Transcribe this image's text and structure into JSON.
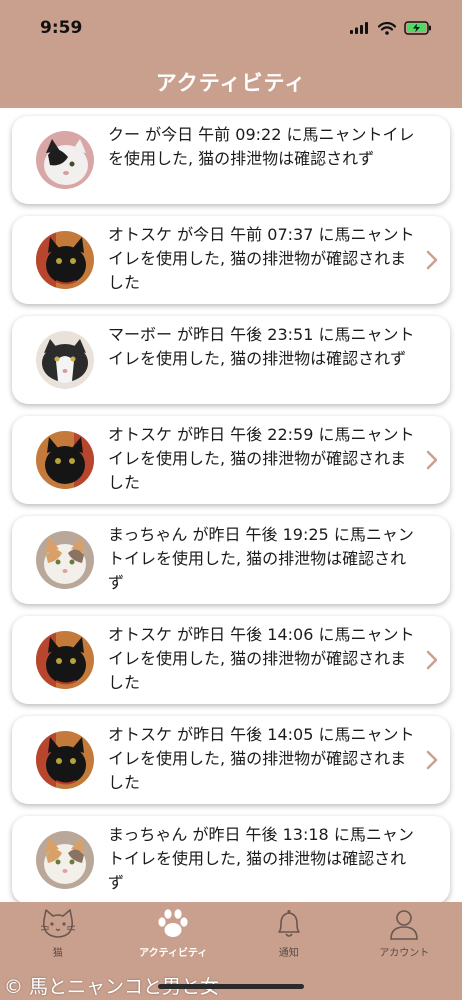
{
  "status_bar": {
    "time": "9:59"
  },
  "header": {
    "title": "アクティビティ"
  },
  "activities": [
    {
      "cat": "kuu",
      "text": "クー が今日 午前 09:22 に馬ニャントイレを使用した, 猫の排泄物は確認されず",
      "has_chevron": false
    },
    {
      "cat": "otosuke",
      "text": "オトスケ が今日 午前 07:37 に馬ニャントイレを使用した, 猫の排泄物が確認されました",
      "has_chevron": true
    },
    {
      "cat": "maabo",
      "text": "マーボー が昨日 午後 23:51 に馬ニャントイレを使用した, 猫の排泄物は確認されず",
      "has_chevron": false
    },
    {
      "cat": "otosuke",
      "text": "オトスケ が昨日 午後 22:59 に馬ニャントイレを使用した, 猫の排泄物が確認されました",
      "has_chevron": true
    },
    {
      "cat": "macchan",
      "text": "まっちゃん が昨日 午後 19:25 に馬ニャントイレを使用した, 猫の排泄物は確認されず",
      "has_chevron": false
    },
    {
      "cat": "otosuke",
      "text": "オトスケ が昨日 午後 14:06 に馬ニャントイレを使用した, 猫の排泄物が確認されました",
      "has_chevron": true
    },
    {
      "cat": "otosuke",
      "text": "オトスケ が昨日 午後 14:05 に馬ニャントイレを使用した, 猫の排泄物が確認されました",
      "has_chevron": true
    },
    {
      "cat": "macchan",
      "text": "まっちゃん が昨日 午後 13:18 に馬ニャントイレを使用した, 猫の排泄物は確認されず",
      "has_chevron": false
    }
  ],
  "tab_bar": {
    "tabs": [
      {
        "label": "猫",
        "icon": "cat-face-icon",
        "active": false
      },
      {
        "label": "アクティビティ",
        "icon": "paw-icon",
        "active": true
      },
      {
        "label": "通知",
        "icon": "bell-icon",
        "active": false
      },
      {
        "label": "アカウント",
        "icon": "person-icon",
        "active": false
      }
    ]
  },
  "watermark": "© 馬とニャンコと男と女",
  "colors": {
    "brand": "#c9a08e",
    "chevron": "#c9a08e"
  }
}
